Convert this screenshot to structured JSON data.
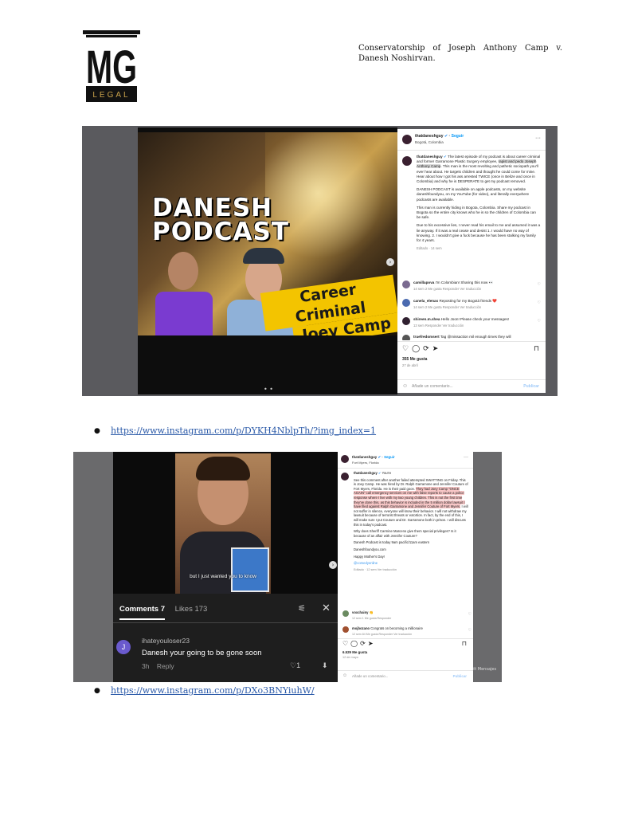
{
  "header": {
    "logo_letters": "MG",
    "logo_sub": "LEGAL",
    "case_line1": "Conservatorship of Joseph Anthony Camp v.",
    "case_line2": "Danesh Noshirvan."
  },
  "post1": {
    "video_title": "DANESH PODCAST",
    "banner_line1": "Career Criminal",
    "banner_line2": "Joey Camp",
    "username": "thatdaneshguy",
    "follow": "Seguir",
    "location": "Bogotá, Colombia",
    "caption_p1_a": "The latest episode of my podcast is about career criminal and former Garramone Plastic Surgery employee, ",
    "caption_p1_hl": "rapist and pedo Joseph Anthony Camp",
    "caption_p1_b": ". This man is the most revolting and pathetic sociopath you'll ever hear about. He targets children and thought he could come for mine. Hear about how I got his ass arrested TWICE (once in Belize and once in Colombia) and why he is DESPERATE to get my podcast removed.",
    "caption_p2": "DANESH PODCAST is available on apple podcasts, on my website daneshfoundyou, on my YouTube (for video), and literally everywhere podcasts are available.",
    "caption_p3": "This man is currently hiding in Bogota, Colombia. Share my podcast in Bogota so the entire city knows who he is so the children of Colombia can be safe.",
    "caption_p4": "Due to his excessive lies, I never read his email to me and assumed it was a lie anyway. If it was a real cease and desist 1. I would have no way of knowing. 2. I wouldn't give a fuck because he has been stalking my family for 4 years.",
    "edited": "Editado · 14 sem",
    "comments": [
      {
        "user": "camillapova",
        "text": "I'm Colombian! Sharing this now 👀",
        "meta": "14 sem   2 Me gusta   Responder   Ver traducción"
      },
      {
        "user": "canela_elenas",
        "text": "Reposting for my Bogotá friends ❤️",
        "meta": "14 sem   2 Me gusta   Responder   Ver traducción"
      },
      {
        "user": "shireen.m.shea",
        "text": "Hello Joon! Please check your messages!",
        "meta": "13 sem   Responder   Ver traducción"
      },
      {
        "user": "truefredomsert",
        "text": "Tag @missaction mil enough times they will",
        "meta": ""
      }
    ],
    "likes": "355 Me gusta",
    "date": "27 de abril",
    "add_comment": "Añade un comentario...",
    "publish": "Publicar"
  },
  "link1": "https://www.instagram.com/p/DYKH4NblpTh/?img_index=1",
  "post2": {
    "subtitle": "but I just wanted you to know",
    "tab_comments": "Comments 7",
    "tab_likes": "Likes 173",
    "comment_avatar": "J",
    "comment_user": "ihateyouloser23",
    "comment_text": "Danesh your going to be gone soon",
    "comment_time": "3h",
    "comment_reply": "Reply",
    "comment_likes": "1",
    "username": "thatdaneshguy",
    "follow": "Seguir",
    "location": "Fort Myers, Florida",
    "caption_a": "See this comment after another failed attempted SWATTING on Friday. This is Joey Camp. He was hired by Dr. Ralph Garramone and Jennifer Couture of Fort Myers, Florida. He is their paid goon. ",
    "caption_hl": "They had Joey Camp \"ONCE AGAIN\" call emergency services on me with false reports to cause a police response where I live with my two young children. This is not the first time they've done this, as this behavior is included in the 5 million dollar lawsuit I have filed against Ralph Garramone and Jennifer Couture of Fort Myers.",
    "caption_b": " I will not suffer in silence, everyone will know their behavior. I will not withdraw my lawsuit because of terrorist threats or extortion. In fact, by the end of this, I will make sure I put Couture and Dr. Garramone both in prison. I will discuss this in today's podcast.",
    "caption_p2": "Why does Sheriff Carmine Marceno give them special privileges? Is it because of an affair with Jennifer Couture?",
    "caption_p3": "Danesh Podcast is today 9am pacific/11am eastern",
    "caption_p4": "Daneshfoundyou.com",
    "caption_p5": "Happy Mother's Day!",
    "caption_tag": "@comedyonline",
    "edited": "Editado · 12 sem   Ver traducción",
    "comments": [
      {
        "user": "voxchainy",
        "text": "👏",
        "meta": "12 sem   1 Me gusta   Responder"
      },
      {
        "user": "mojbozano",
        "text": "Congrats on becoming a millionaire",
        "meta": "12 sem   84 Me gusta   Responder   Ver traducción"
      }
    ],
    "likes": "6.529 Me gusta",
    "date": "12 de mayo",
    "add_comment": "Añade un comentario...",
    "publish": "Publicar",
    "messages": "Mensajes"
  },
  "link2": "https://www.instagram.com/p/DXo3BNYiuhW/"
}
